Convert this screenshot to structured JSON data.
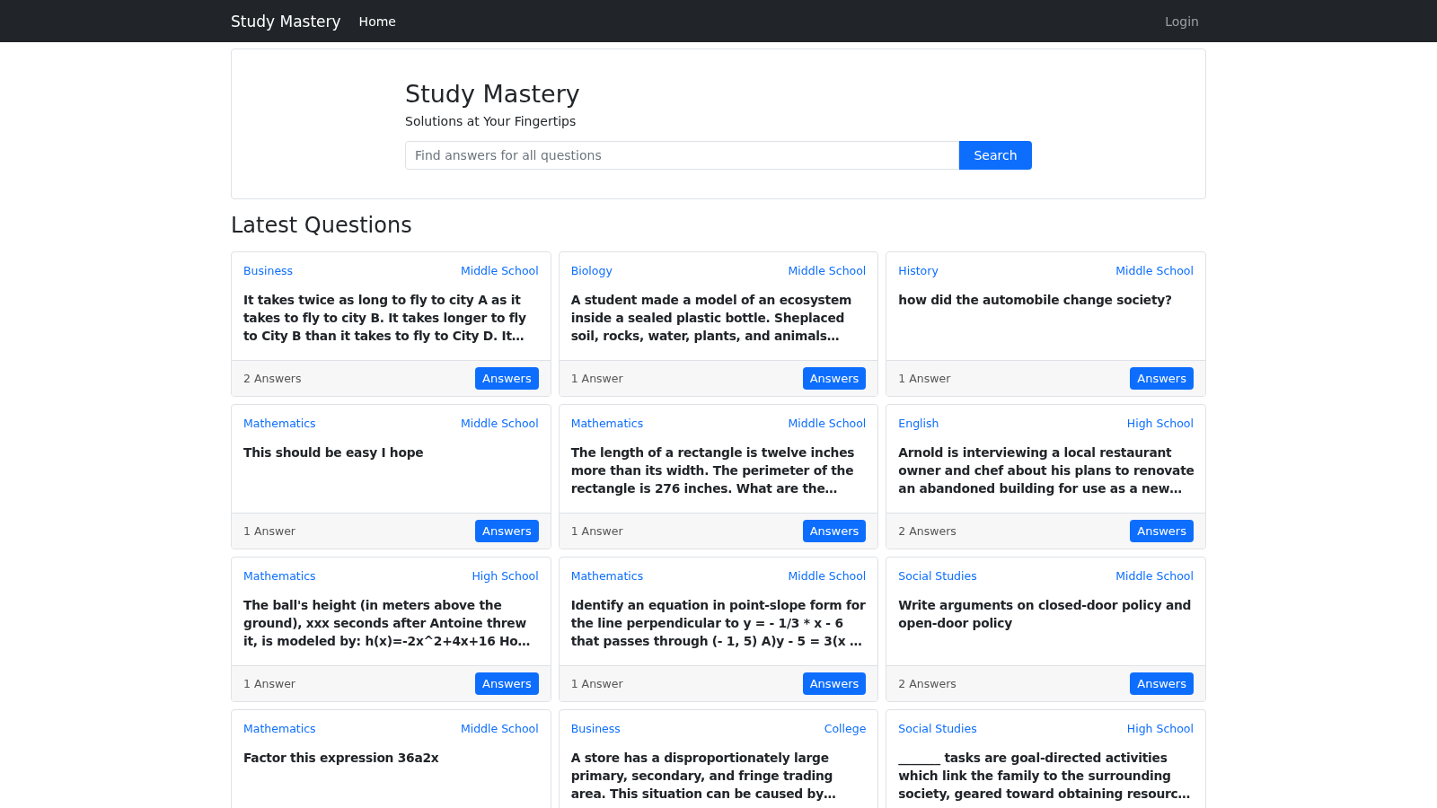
{
  "navbar": {
    "brand": "Study Mastery",
    "links": [
      {
        "label": "Home",
        "selected": true
      }
    ],
    "login": "Login"
  },
  "hero": {
    "title": "Study Mastery",
    "subtitle": "Solutions at Your Fingertips",
    "search": {
      "placeholder": "Find answers for all questions",
      "button": "Search"
    }
  },
  "section_title": "Latest Questions",
  "questions": [
    {
      "subject": "Business",
      "level": "Middle School",
      "text": "It takes twice as long to fly to city A as it takes to fly to city B. It takes longer to fly to City B than it takes to fly to City D. It…",
      "answers_count": "2 Answers",
      "button": "Answers"
    },
    {
      "subject": "Biology",
      "level": "Middle School",
      "text": "A student made a model of an ecosystem inside a sealed plastic bottle. Sheplaced soil, rocks, water, plants, and animals…",
      "answers_count": "1 Answer",
      "button": "Answers"
    },
    {
      "subject": "History",
      "level": "Middle School",
      "text": "how did the automobile change society?",
      "answers_count": "1 Answer",
      "button": "Answers"
    },
    {
      "subject": "Mathematics",
      "level": "Middle School",
      "text": "This should be easy I hope",
      "answers_count": "1 Answer",
      "button": "Answers"
    },
    {
      "subject": "Mathematics",
      "level": "Middle School",
      "text": "The length of a rectangle is twelve inches more than its width. The perimeter of the rectangle is 276 inches. What are the…",
      "answers_count": "1 Answer",
      "button": "Answers"
    },
    {
      "subject": "English",
      "level": "High School",
      "text": "Arnold is interviewing a local restaurant owner and chef about his plans to renovate an abandoned building for use as a new…",
      "answers_count": "2 Answers",
      "button": "Answers"
    },
    {
      "subject": "Mathematics",
      "level": "High School",
      "text": "The ball's height (in meters above the ground), xxx seconds after Antoine threw it, is modeled by: h(x)=-2x^2+4x+16 Ho…",
      "answers_count": "1 Answer",
      "button": "Answers"
    },
    {
      "subject": "Mathematics",
      "level": "Middle School",
      "text": "Identify an equation in point-slope form for the line perpendicular to y = - 1/3 * x - 6 that passes through (- 1, 5) A)y - 5 = 3(x …",
      "answers_count": "1 Answer",
      "button": "Answers"
    },
    {
      "subject": "Social Studies",
      "level": "Middle School",
      "text": "Write arguments on closed-door policy and open-door policy",
      "answers_count": "2 Answers",
      "button": "Answers"
    },
    {
      "subject": "Mathematics",
      "level": "Middle School",
      "text": "Factor this expression 36a2x"
    },
    {
      "subject": "Business",
      "level": "College",
      "text": "A store has a disproportionately large primary, secondary, and fringe trading area. This situation can be caused by…"
    },
    {
      "subject": "Social Studies",
      "level": "High School",
      "text": "_______ tasks are goal-directed activities which link the family to the surrounding society, geared toward obtaining resourc…"
    }
  ]
}
